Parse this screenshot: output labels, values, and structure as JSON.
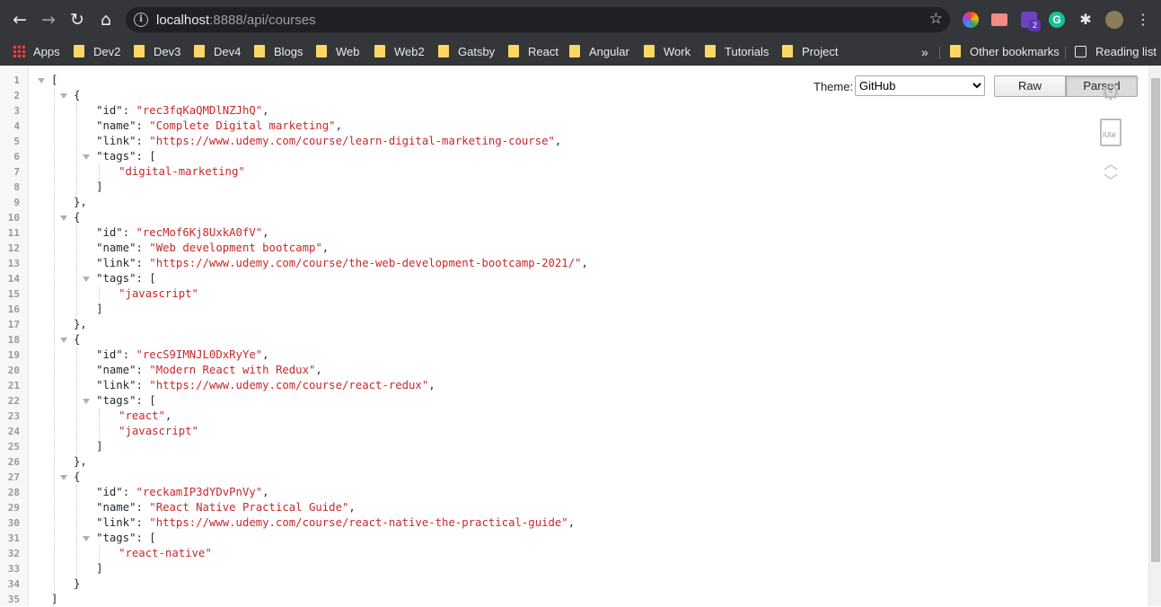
{
  "browser": {
    "url_host": "localhost",
    "url_rest": ":8888/api/courses",
    "extension_badge": "2"
  },
  "bookmarks": {
    "apps": "Apps",
    "folders": [
      "Dev2",
      "Dev3",
      "Dev4",
      "Blogs",
      "Web",
      "Web2",
      "Gatsby",
      "React",
      "Angular",
      "Work",
      "Tutorials",
      "Project"
    ],
    "overflow": "»",
    "other": "Other bookmarks",
    "reading_list": "Reading list"
  },
  "viewer": {
    "theme_label": "Theme:",
    "theme_value": "GitHub",
    "raw_button": "Raw",
    "parsed_button": "Parsed",
    "raw_icon_label": "RAW"
  },
  "json_lines": [
    "[",
    "    {",
    "        \"id\": \"rec3fqKaQMDlNZJhQ\",",
    "        \"name\": \"Complete Digital marketing\",",
    "        \"link\": \"https://www.udemy.com/course/learn-digital-marketing-course\",",
    "        \"tags\": [",
    "            \"digital-marketing\"",
    "        ]",
    "    },",
    "    {",
    "        \"id\": \"recMof6Kj8UxkA0fV\",",
    "        \"name\": \"Web development bootcamp\",",
    "        \"link\": \"https://www.udemy.com/course/the-web-development-bootcamp-2021/\",",
    "        \"tags\": [",
    "            \"javascript\"",
    "        ]",
    "    },",
    "    {",
    "        \"id\": \"recS9IMNJL0DxRyYe\",",
    "        \"name\": \"Modern React with Redux\",",
    "        \"link\": \"https://www.udemy.com/course/react-redux\",",
    "        \"tags\": [",
    "            \"react\",",
    "            \"javascript\"",
    "        ]",
    "    },",
    "    {",
    "        \"id\": \"reckamIP3dYDvPnVy\",",
    "        \"name\": \"React Native Practical Guide\",",
    "        \"link\": \"https://www.udemy.com/course/react-native-the-practical-guide\",",
    "        \"tags\": [",
    "            \"react-native\"",
    "        ]",
    "    }",
    "]"
  ]
}
